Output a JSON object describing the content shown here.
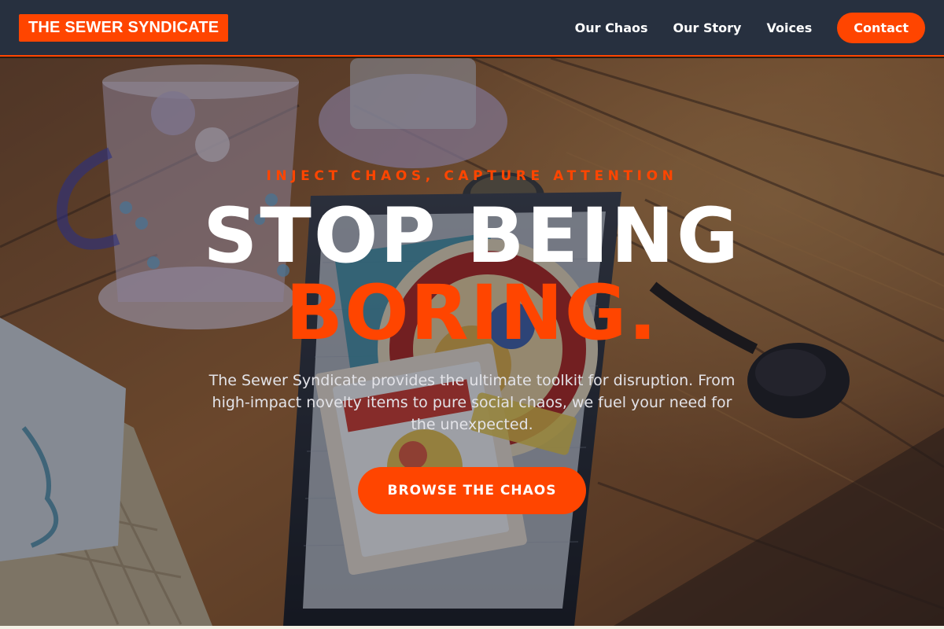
{
  "nav": {
    "logo": "THE SEWER SYNDICATE",
    "links": [
      {
        "label": "Our Chaos"
      },
      {
        "label": "Our Story"
      },
      {
        "label": "Voices"
      }
    ],
    "contact_label": "Contact"
  },
  "hero": {
    "tagline": "INJECT CHAOS, CAPTURE ATTENTION",
    "headline_line1": "STOP BEING",
    "headline_line2": "BORING.",
    "description": "The Sewer Syndicate provides the ultimate toolkit for disruption. From high-impact novelty items to pure social chaos, we fuel your need for the unexpected.",
    "cta_label": "BROWSE THE CHAOS"
  },
  "colors": {
    "accent": "#ff4500",
    "nav_background": "#27303f",
    "text_primary": "#ffffff"
  }
}
